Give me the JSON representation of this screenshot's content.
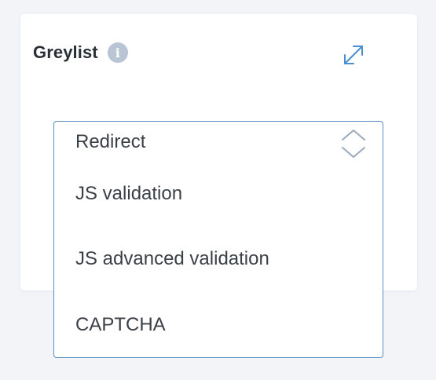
{
  "card": {
    "title": "Greylist",
    "info_icon": "info-icon",
    "info_glyph": "i",
    "expand_icon": "expand-icon"
  },
  "select": {
    "selected": "Redirect",
    "options": [
      "JS validation",
      "JS advanced validation",
      "CAPTCHA"
    ],
    "chevron_icon": "chevron-updown-icon"
  },
  "colors": {
    "page_bg": "#f2f4f8",
    "card_bg": "#ffffff",
    "accent_border": "#5a8fc6",
    "info_icon_bg": "#b9c4d4",
    "text": "#3b4046"
  }
}
